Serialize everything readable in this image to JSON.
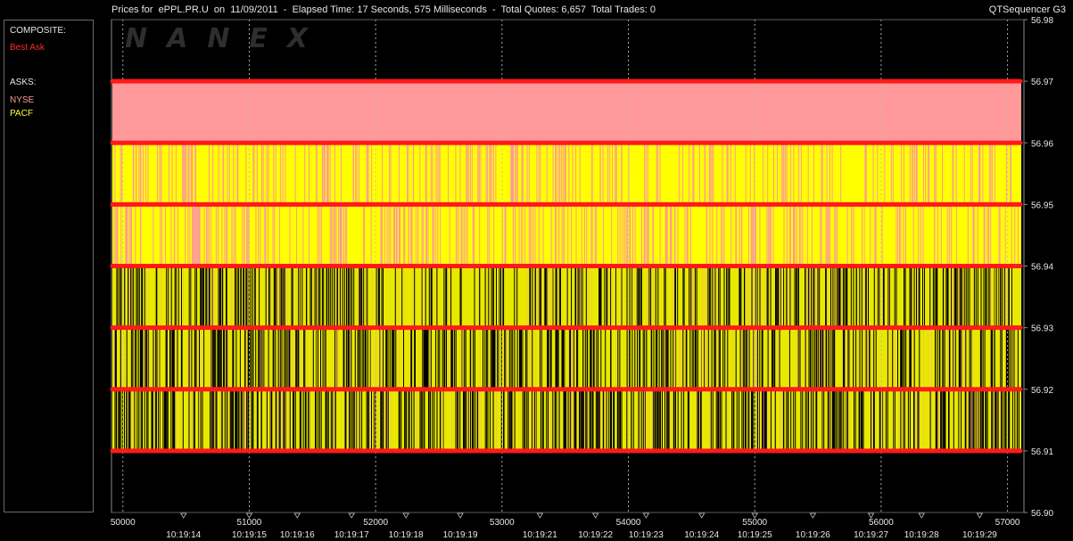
{
  "header": {
    "title": "Prices for  ePPL.PR.U  on  11/09/2011  -  Elapsed Time: 17 Seconds, 575 Milliseconds  -  Total Quotes: 6,657  Total Trades: 0",
    "app_name": "QTSequencer G3"
  },
  "legend": {
    "composite_heading": "COMPOSITE:",
    "composite_item": "Best Ask",
    "asks_heading": "ASKS:",
    "asks_items": [
      "NYSE",
      "PACF"
    ]
  },
  "watermark": "NANEX",
  "colors": {
    "background": "#000000",
    "best_ask": "#ff1a1a",
    "nyse": "#ff9999",
    "pacf": "#ffff00",
    "gridline": "#bdbdbd",
    "plot_border": "#8a8a8a",
    "text": "#e6e6e6"
  },
  "chart_data": {
    "type": "scatter",
    "title": "",
    "xlabel": "",
    "ylabel": "",
    "xlim": [
      49910,
      57130
    ],
    "ylim": [
      56.9,
      56.98
    ],
    "y_ticks": [
      "56.98",
      "56.97",
      "56.96",
      "56.95",
      "56.94",
      "56.93",
      "56.92",
      "56.91",
      "56.90"
    ],
    "x_ticks_sequence": [
      "50000",
      "51000",
      "52000",
      "53000",
      "54000",
      "55000",
      "56000",
      "57000"
    ],
    "x_ticks_time": [
      {
        "seq": 50480,
        "label": "10:19:14"
      },
      {
        "seq": 51000,
        "label": "10:19:15"
      },
      {
        "seq": 51380,
        "label": "10:19:16"
      },
      {
        "seq": 51810,
        "label": "10:19:17"
      },
      {
        "seq": 52240,
        "label": "10:19:18"
      },
      {
        "seq": 52670,
        "label": "10:19:19"
      },
      {
        "seq": 53300,
        "label": "10:19:21"
      },
      {
        "seq": 53740,
        "label": "10:19:22"
      },
      {
        "seq": 54140,
        "label": "10:19:23"
      },
      {
        "seq": 54580,
        "label": "10:19:24"
      },
      {
        "seq": 55000,
        "label": "10:19:25"
      },
      {
        "seq": 55460,
        "label": "10:19:26"
      },
      {
        "seq": 55920,
        "label": "10:19:27"
      },
      {
        "seq": 56320,
        "label": "10:19:28"
      },
      {
        "seq": 56780,
        "label": "10:19:29"
      }
    ],
    "series": [
      {
        "name": "Best Ask",
        "style": "dots",
        "price_levels": [
          56.97,
          56.96,
          56.95,
          56.94,
          56.93,
          56.92,
          56.91
        ]
      },
      {
        "name": "NYSE",
        "style": "band",
        "range": [
          56.96,
          56.97
        ]
      },
      {
        "name": "PACF",
        "style": "vertical-lines",
        "range": [
          56.91,
          56.96
        ]
      }
    ],
    "grid": true,
    "legend_position": "left"
  }
}
